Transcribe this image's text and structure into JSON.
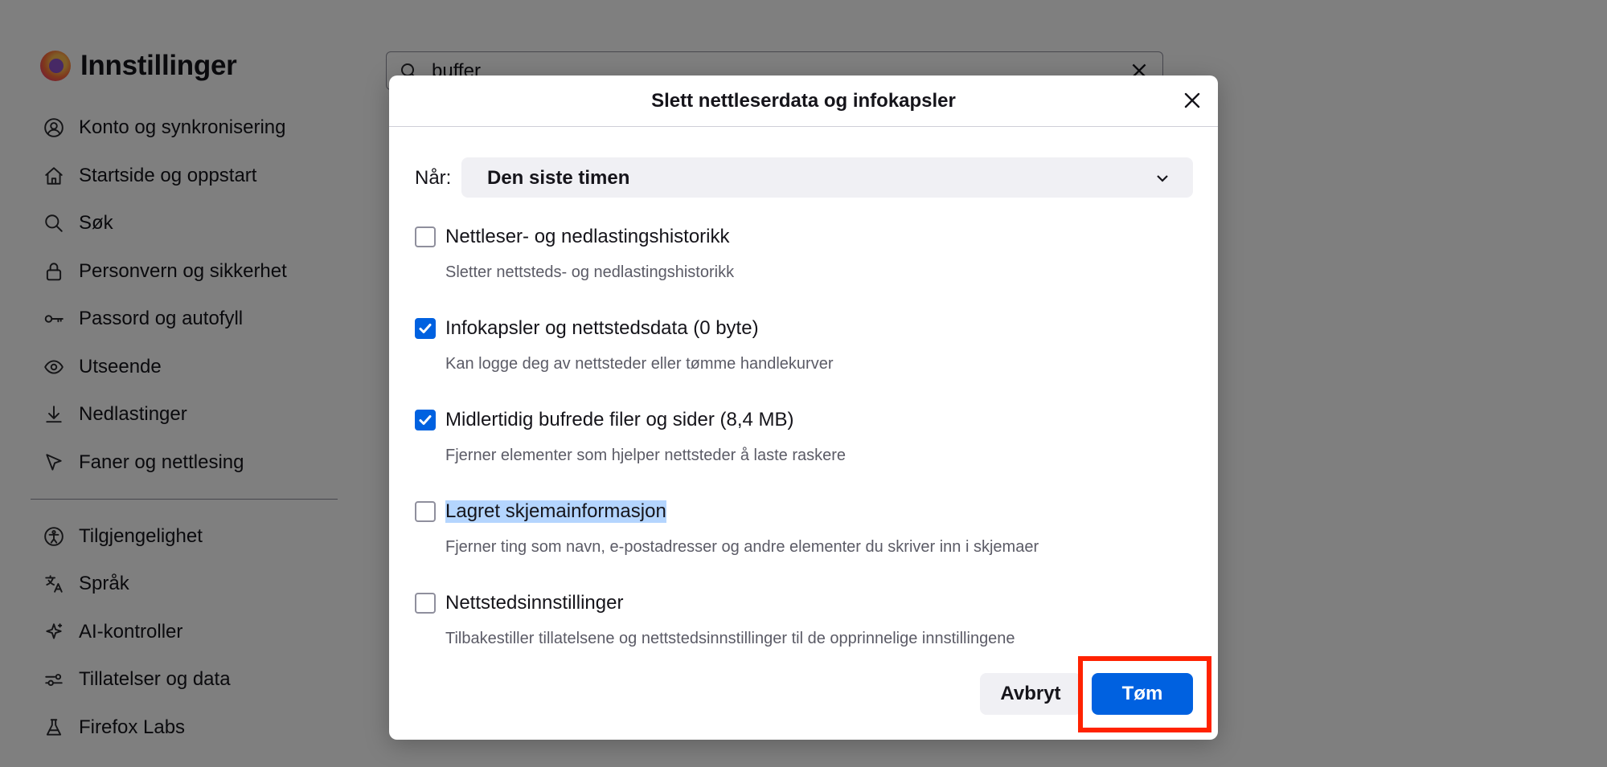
{
  "window": {
    "title": "Innstillinger"
  },
  "sidebar": {
    "items": [
      {
        "label": "Konto og synkronisering",
        "icon": "account-icon"
      },
      {
        "label": "Startside og oppstart",
        "icon": "home-icon"
      },
      {
        "label": "Søk",
        "icon": "search-icon"
      },
      {
        "label": "Personvern og sikkerhet",
        "icon": "lock-icon"
      },
      {
        "label": "Passord og autofyll",
        "icon": "key-icon"
      },
      {
        "label": "Utseende",
        "icon": "eye-icon"
      },
      {
        "label": "Nedlastinger",
        "icon": "download-icon"
      },
      {
        "label": "Faner og nettlesing",
        "icon": "cursor-icon"
      }
    ],
    "secondary_items": [
      {
        "label": "Tilgjengelighet",
        "icon": "accessibility-icon"
      },
      {
        "label": "Språk",
        "icon": "translate-icon"
      },
      {
        "label": "AI-kontroller",
        "icon": "sparkle-icon"
      },
      {
        "label": "Tillatelser og data",
        "icon": "sliders-icon"
      },
      {
        "label": "Firefox Labs",
        "icon": "flask-icon"
      }
    ]
  },
  "search": {
    "value": "buffer"
  },
  "dialog": {
    "title": "Slett nettleserdata og infokapsler",
    "when_label": "Når:",
    "when_value": "Den siste timen",
    "options": [
      {
        "label": "Nettleser- og nedlastingshistorikk",
        "description": "Sletter nettsteds- og nedlastingshistorikk",
        "checked": false
      },
      {
        "label": "Infokapsler og nettstedsdata (0 byte)",
        "description": "Kan logge deg av nettsteder eller tømme handlekurver",
        "checked": true
      },
      {
        "label": "Midlertidig bufrede filer og sider (8,4 MB)",
        "description": "Fjerner elementer som hjelper nettsteder å laste raskere",
        "checked": true
      },
      {
        "label": "Lagret skjemainformasjon",
        "description": "Fjerner ting som navn, e-postadresser og andre elementer du skriver inn i skjemaer",
        "checked": false
      },
      {
        "label": "Nettstedsinnstillinger",
        "description": "Tilbakestiller tillatelsene og nettstedsinnstillinger til de opprinnelige innstillingene",
        "checked": false
      }
    ],
    "cancel_label": "Avbryt",
    "clear_label": "Tøm"
  },
  "colors": {
    "accent": "#0061e0",
    "overlay": "#000000",
    "highlight": "#ff2200",
    "selection": "#b4d5fe"
  }
}
